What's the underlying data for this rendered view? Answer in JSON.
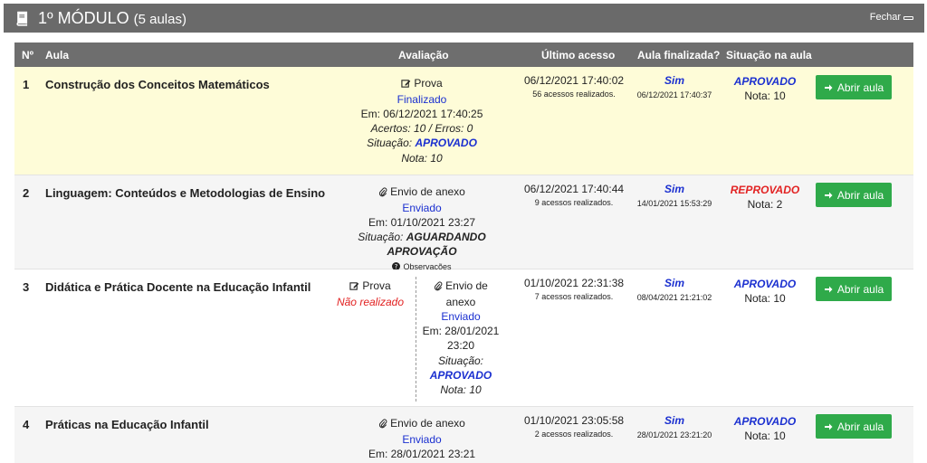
{
  "module": {
    "title": "1º MÓDULO",
    "count": "(5 aulas)",
    "close_label": "Fechar"
  },
  "table": {
    "headers": {
      "num": "Nº",
      "lesson": "Aula",
      "evaluation": "Avaliação",
      "last_access": "Último acesso",
      "finished": "Aula finalizada?",
      "situation": "Situação na aula"
    },
    "rows": [
      {
        "num": "1",
        "lesson": "Construção dos Conceitos Matemáticos",
        "evaluations": [
          {
            "type": "Prova",
            "status": "Finalizado",
            "date": "Em: 06/12/2021 17:40:25",
            "score": "Acertos: 10 / Erros: 0",
            "situation_label": "Situação:",
            "situation": "APROVADO",
            "grade": "Nota: 10"
          }
        ],
        "last_access": "06/12/2021 17:40:02",
        "access_count": "56 acessos realizados.",
        "finished": "Sim",
        "finished_date": "06/12/2021 17:40:37",
        "situation": "APROVADO",
        "grade": "Nota: 10",
        "button": "Abrir aula"
      },
      {
        "num": "2",
        "lesson": "Linguagem: Conteúdos e Metodologias de Ensino",
        "evaluations": [
          {
            "type": "Envio de anexo",
            "status": "Enviado",
            "date": "Em: 01/10/2021 23:27",
            "situation_label": "Situação:",
            "situation": "AGUARDANDO APROVAÇÃO",
            "notes": "Observações"
          }
        ],
        "last_access": "06/12/2021 17:40:44",
        "access_count": "9 acessos realizados.",
        "finished": "Sim",
        "finished_date": "14/01/2021 15:53:29",
        "situation": "REPROVADO",
        "grade": "Nota: 2",
        "button": "Abrir aula"
      },
      {
        "num": "3",
        "lesson": "Didática e Prática Docente na Educação Infantil",
        "evaluations": [
          {
            "type": "Prova",
            "status": "Não realizado"
          },
          {
            "type_line1": "Envio de",
            "type_line2": "anexo",
            "status": "Enviado",
            "date_line1": "Em: 28/01/2021",
            "date_line2": "23:20",
            "situation_label": "Situação:",
            "situation": "APROVADO",
            "grade": "Nota: 10"
          }
        ],
        "last_access": "01/10/2021 22:31:38",
        "access_count": "7 acessos realizados.",
        "finished": "Sim",
        "finished_date": "08/04/2021 21:21:02",
        "situation": "APROVADO",
        "grade": "Nota: 10",
        "button": "Abrir aula"
      },
      {
        "num": "4",
        "lesson": "Práticas na Educação Infantil",
        "evaluations": [
          {
            "type": "Envio de anexo",
            "status": "Enviado",
            "date": "Em: 28/01/2021 23:21"
          }
        ],
        "last_access": "01/10/2021 23:05:58",
        "access_count": "2 acessos realizados.",
        "finished": "Sim",
        "finished_date": "28/01/2021 23:21:20",
        "situation": "APROVADO",
        "grade": "Nota: 10",
        "button": "Abrir aula"
      }
    ]
  },
  "icons": {
    "module": "book-icon",
    "close": "minus-icon",
    "exam": "edit-icon",
    "attachment": "paperclip-icon",
    "notes": "question-circle-icon",
    "open": "arrow-right-icon"
  },
  "colors": {
    "header_bg": "#6a6a6a",
    "highlight_row": "#fefcd8",
    "approved": "#1a2fd0",
    "failed": "#e22222",
    "button": "#2faa4a"
  }
}
